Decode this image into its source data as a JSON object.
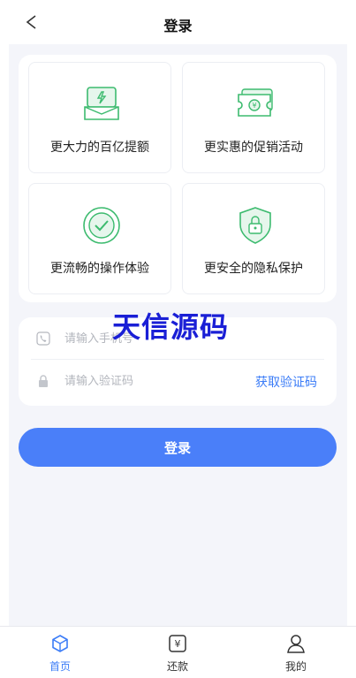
{
  "header": {
    "title": "登录",
    "back_icon": "chevron-left-icon"
  },
  "features": [
    {
      "label": "更大力的百亿提额",
      "icon": "wallet-up-icon"
    },
    {
      "label": "更实惠的促销活动",
      "icon": "coupon-icon"
    },
    {
      "label": "更流畅的操作体验",
      "icon": "check-circle-icon"
    },
    {
      "label": "更安全的隐私保护",
      "icon": "shield-lock-icon"
    }
  ],
  "form": {
    "phone_placeholder": "请输入手机号",
    "code_placeholder": "请输入验证码",
    "get_code": "获取验证码"
  },
  "watermark": "天信源码",
  "login_button": "登录",
  "tabs": [
    {
      "label": "首页",
      "icon": "cube-icon",
      "active": true
    },
    {
      "label": "还款",
      "icon": "repay-icon",
      "active": false
    },
    {
      "label": "我的",
      "icon": "user-icon",
      "active": false
    }
  ],
  "colors": {
    "accent": "#4a7ff9",
    "feature_icon": "#3dbb6f",
    "link": "#3b7cf7"
  }
}
